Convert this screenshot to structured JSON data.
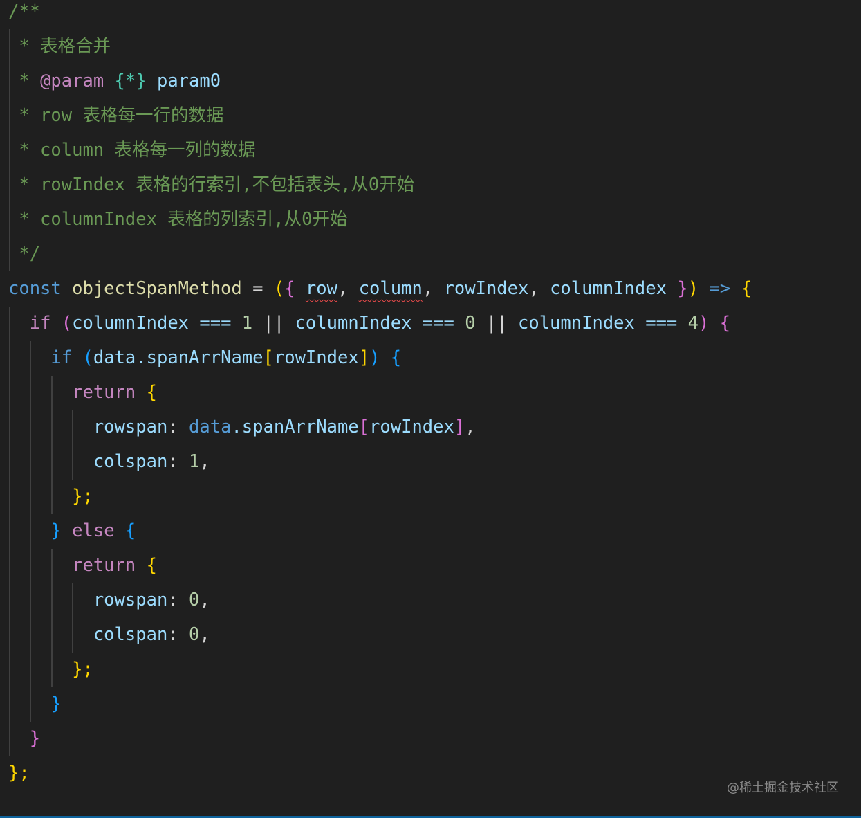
{
  "code": {
    "comment_block": {
      "l1": "/**",
      "l2": " * 表格合并",
      "l3_star": " * ",
      "l3_tag": "@param",
      "l3_type": "{*}",
      "l3_name": " param0",
      "l4": " * row 表格每一行的数据",
      "l5": " * column 表格每一列的数据",
      "l6": " * rowIndex 表格的行索引,不包括表头,从0开始",
      "l7": " * columnIndex 表格的列索引,从0开始",
      "l8": " */"
    },
    "decl": {
      "kw_const": "const",
      "fn_name": "objectSpanMethod",
      "assign": " = ",
      "paren_open": "(",
      "brace_open": "{",
      "param_row": "row",
      "comma1": ", ",
      "param_column": "column",
      "comma2": ", ",
      "param_rowIndex": "rowIndex",
      "comma3": ", ",
      "param_columnIndex": "columnIndex",
      "brace_close": " }",
      "paren_close": ")",
      "arrow": " => ",
      "body_open": "{"
    },
    "if1": {
      "kw": "if",
      "paren_open": " (",
      "cond_a": "columnIndex === ",
      "num_a": "1",
      "or_a": " || ",
      "cond_b": "columnIndex === ",
      "num_b": "0",
      "or_b": " || ",
      "cond_c": "columnIndex === ",
      "num_c": "4",
      "paren_close": ")",
      "brace": " {"
    },
    "if2": {
      "kw": "if",
      "paren_open": " (",
      "obj": "data",
      "dot": ".spanArrName",
      "br_open": "[",
      "idx": "rowIndex",
      "br_close": "]",
      "paren_close": ")",
      "brace": " {"
    },
    "return1": {
      "kw": "return",
      "brace": " {"
    },
    "rowspan1": {
      "key": "rowspan",
      "colon": ": ",
      "obj": "data",
      "dot": ".spanArrName",
      "br_open": "[",
      "idx": "rowIndex",
      "br_close": "]",
      "comma": ","
    },
    "colspan1": {
      "key": "colspan",
      "colon": ": ",
      "num": "1",
      "comma": ","
    },
    "close1": "};",
    "else_line": {
      "close": "}",
      "kw": " else",
      "open": " {"
    },
    "return2": {
      "kw": "return",
      "brace": " {"
    },
    "rowspan2": {
      "key": "rowspan",
      "colon": ": ",
      "num": "0",
      "comma": ","
    },
    "colspan2": {
      "key": "colspan",
      "colon": ": ",
      "num": "0",
      "comma": ","
    },
    "close2": "};",
    "close_else": "}",
    "close_if1": "}",
    "close_fn": "};"
  },
  "watermark": "@稀土掘金技术社区",
  "colors": {
    "background": "#1f1f1f",
    "comment": "#6a9955",
    "keyword": "#c586c0",
    "storage": "#569cd6",
    "identifier": "#9cdcfe",
    "function": "#dcdcaa",
    "number": "#b5cea8",
    "bracket_gold": "#ffd700",
    "bracket_pink": "#da70d6",
    "bracket_blue": "#179fff",
    "error_squiggle": "#f14c4c"
  }
}
